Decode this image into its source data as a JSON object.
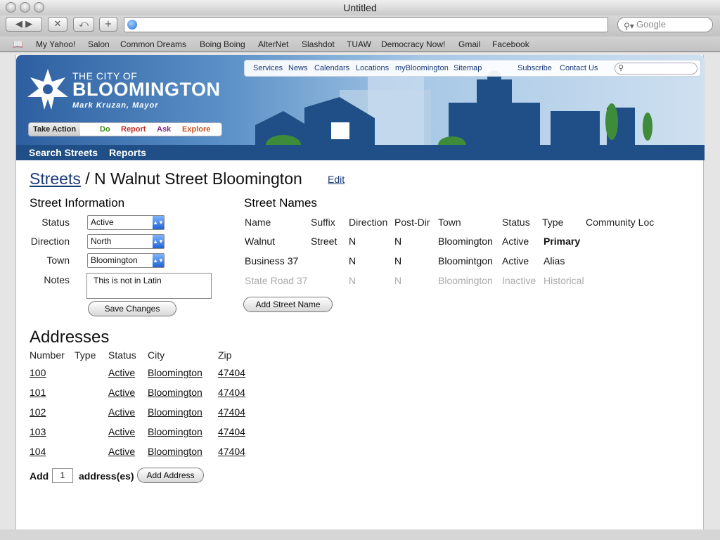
{
  "browser": {
    "title": "Untitled",
    "search_placeholder": "Google",
    "bookmarks": [
      "My Yahoo!",
      "Salon",
      "Common Dreams",
      "Boing Boing",
      "AlterNet",
      "Slashdot",
      "TUAW",
      "Democracy Now!",
      "Gmail",
      "Facebook"
    ]
  },
  "site": {
    "logo_line1": "THE CITY OF",
    "logo_line2": "BLOOMINGTON",
    "logo_line3": "Mark Kruzan, Mayor",
    "topnav": [
      "Services",
      "News",
      "Calendars",
      "Locations",
      "myBloomington",
      "Sitemap",
      "Subscribe",
      "Contact Us"
    ],
    "take_action": {
      "label": "Take Action",
      "items": [
        "Do",
        "Report",
        "Ask",
        "Explore"
      ]
    },
    "nav": [
      "Search Streets",
      "Reports"
    ]
  },
  "page": {
    "breadcrumb_link": "Streets",
    "title": "/ N Walnut Street Bloomington",
    "edit": "Edit"
  },
  "street_info": {
    "heading": "Street Information",
    "status_label": "Status",
    "status_value": "Active",
    "direction_label": "Direction",
    "direction_value": "North",
    "town_label": "Town",
    "town_value": "Bloomington",
    "notes_label": "Notes",
    "notes_value": "This is not in Latin",
    "save_button": "Save Changes"
  },
  "street_names": {
    "heading": "Street Names",
    "columns": [
      "Name",
      "Suffix",
      "Direction",
      "Post-Dir",
      "Town",
      "Status",
      "Type",
      "Community Loc"
    ],
    "rows": [
      [
        "Walnut",
        "Street",
        "N",
        "N",
        "Bloomington",
        "Active",
        "Primary",
        ""
      ],
      [
        "Business 37",
        "",
        "N",
        "N",
        "Bloomintgon",
        "Active",
        "Alias",
        ""
      ],
      [
        "State Road 37",
        "",
        "N",
        "N",
        "Bloomington",
        "Inactive",
        "Historical",
        ""
      ]
    ],
    "add_button": "Add Street Name"
  },
  "addresses": {
    "heading": "Addresses",
    "columns": [
      "Number",
      "Type",
      "Status",
      "City",
      "Zip"
    ],
    "rows": [
      [
        "100",
        "",
        "Active",
        "Bloomington",
        "47404"
      ],
      [
        "101",
        "",
        "Active",
        "Bloomington",
        "47404"
      ],
      [
        "102",
        "",
        "Active",
        "Bloomington",
        "47404"
      ],
      [
        "103",
        "",
        "Active",
        "Bloomington",
        "47404"
      ],
      [
        "104",
        "",
        "Active",
        "Bloomington",
        "47404"
      ]
    ],
    "add_label": "Add",
    "add_count": "1",
    "add_suffix": "address(es)",
    "add_button": "Add Address"
  },
  "colors": {
    "brand_blue": "#1f4f86",
    "link": "#1a3a78"
  }
}
